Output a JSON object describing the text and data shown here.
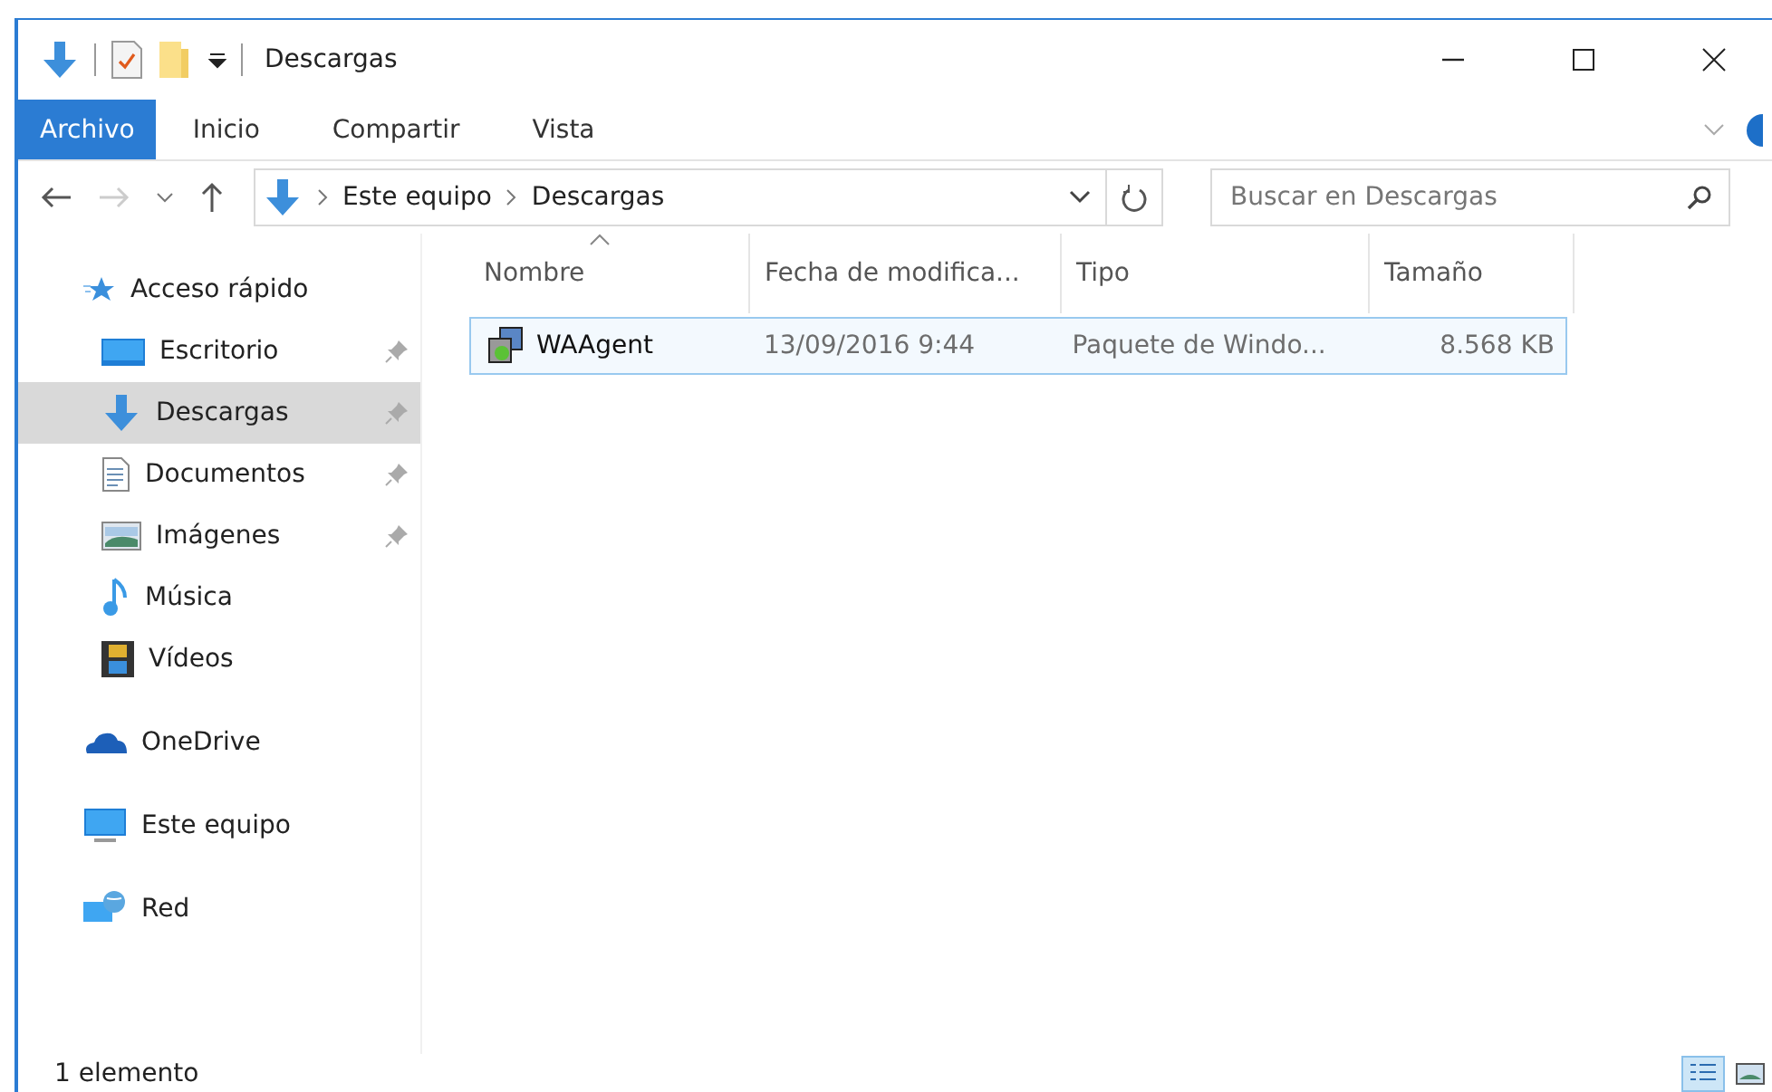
{
  "window": {
    "title": "Descargas"
  },
  "ribbon_tabs": [
    {
      "label": "Archivo",
      "selected": true
    },
    {
      "label": "Inicio",
      "selected": false
    },
    {
      "label": "Compartir",
      "selected": false
    },
    {
      "label": "Vista",
      "selected": false
    }
  ],
  "address_bar": {
    "path": [
      "Este equipo",
      "Descargas"
    ]
  },
  "search": {
    "placeholder": "Buscar en Descargas"
  },
  "sidebar": {
    "items": [
      {
        "label": "Acceso rápido",
        "kind": "star",
        "selected": false,
        "children": [
          {
            "label": "Escritorio",
            "kind": "desktop",
            "selected": false,
            "pinned": true
          },
          {
            "label": "Descargas",
            "kind": "download",
            "selected": true,
            "pinned": true
          },
          {
            "label": "Documentos",
            "kind": "document",
            "selected": false,
            "pinned": true
          },
          {
            "label": "Imágenes",
            "kind": "image",
            "selected": false,
            "pinned": true
          },
          {
            "label": "Música",
            "kind": "music",
            "selected": false,
            "pinned": false
          },
          {
            "label": "Vídeos",
            "kind": "video",
            "selected": false,
            "pinned": false
          }
        ]
      },
      {
        "label": "OneDrive",
        "kind": "cloud",
        "selected": false
      },
      {
        "label": "Este equipo",
        "kind": "computer",
        "selected": false
      },
      {
        "label": "Red",
        "kind": "network",
        "selected": false
      }
    ]
  },
  "table": {
    "columns": [
      {
        "label": "Nombre",
        "sorted": true
      },
      {
        "label": "Fecha de modifica...",
        "sorted": false
      },
      {
        "label": "Tipo",
        "sorted": false
      },
      {
        "label": "Tamaño",
        "sorted": false
      }
    ],
    "rows": [
      {
        "cells": [
          "WAAgent",
          "13/09/2016 9:44",
          "Paquete de Windo...",
          "8.568 KB"
        ],
        "selected": true
      }
    ]
  },
  "status_bar": {
    "text": "1 elemento",
    "views": [
      {
        "kind": "details",
        "selected": true
      },
      {
        "kind": "large-icons",
        "selected": false
      }
    ]
  }
}
